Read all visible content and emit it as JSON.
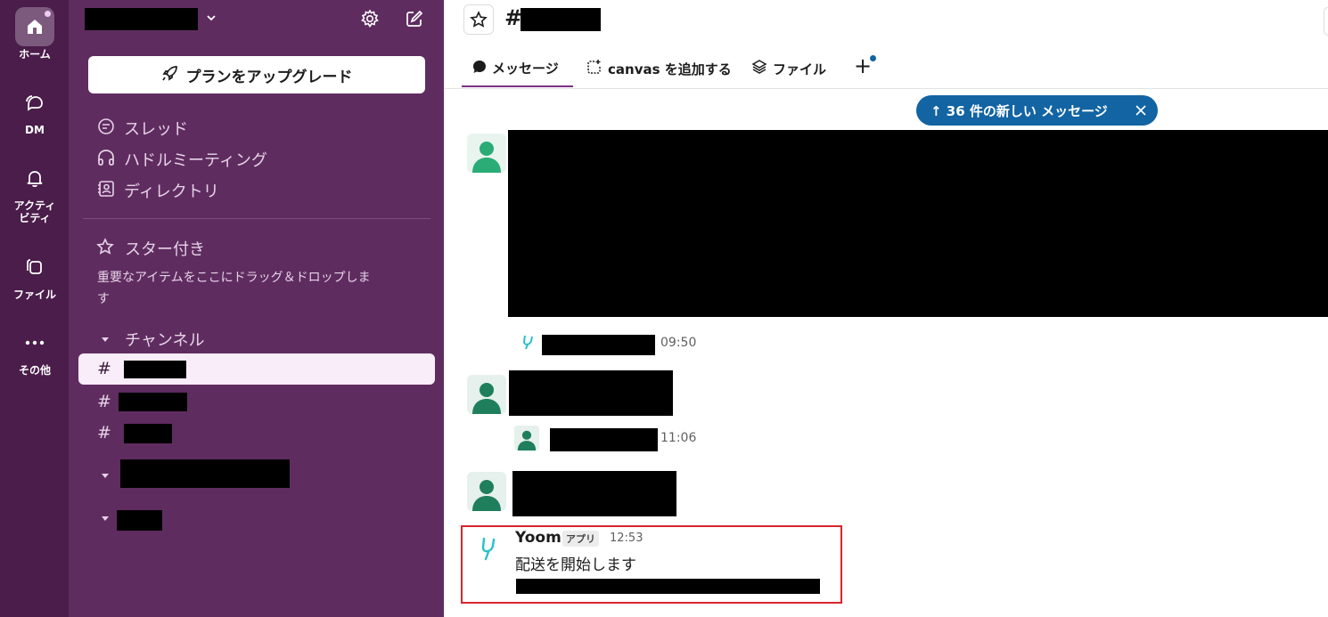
{
  "rail": {
    "home": "ホーム",
    "dm": "DM",
    "activity_line1": "アクティ",
    "activity_line2": "ビティ",
    "files": "ファイル",
    "more": "その他"
  },
  "sidebar": {
    "upgrade_label": "プランをアップグレード",
    "nav": [
      "スレッド",
      "ハドルミーティング",
      "ディレクトリ"
    ],
    "starred_title": "スター付き",
    "starred_hint_line1": "重要なアイテムをここにドラッグ＆ドロップしま",
    "starred_hint_line2": "す",
    "channels_title": "チャンネル",
    "hash": "#"
  },
  "header": {
    "hash": "#"
  },
  "tabs": {
    "messages": "メッセージ",
    "canvas": "canvas を追加する",
    "files": "ファイル",
    "add": "+"
  },
  "new_messages_banner": "↑ 36 件の新しい メッセージ",
  "messages": {
    "time_1": "09:50",
    "time_2": "11:06",
    "yoom": {
      "sender": "Yoom",
      "badge": "アプリ",
      "time": "12:53",
      "text": "配送を開始します"
    }
  },
  "colors": {
    "rail_bg": "#4a1d4a",
    "sidebar_bg": "#5f2c60",
    "banner_bg": "#1264a3",
    "highlight_border": "#d9252c"
  }
}
